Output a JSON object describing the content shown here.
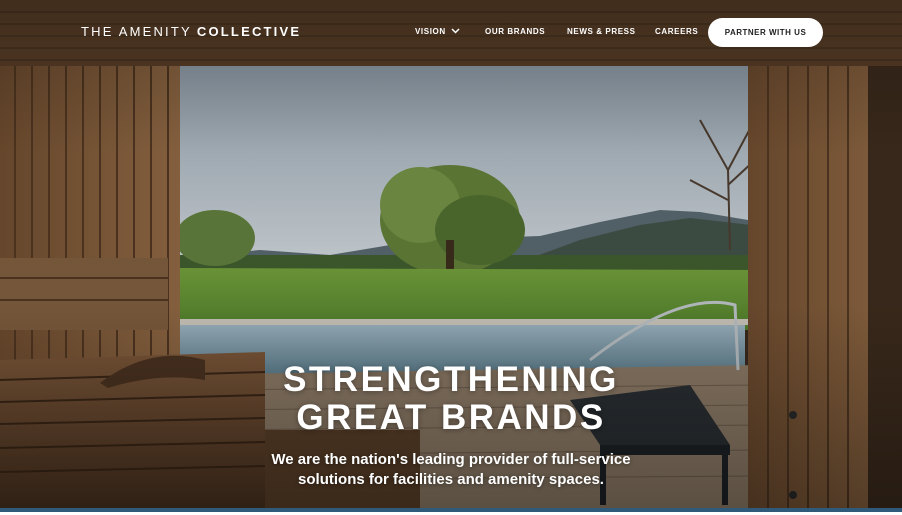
{
  "header": {
    "logo_light": "THE AMENITY",
    "logo_bold": "COLLECTIVE",
    "nav": [
      {
        "label": "VISION",
        "has_dropdown": true
      },
      {
        "label": "OUR BRANDS"
      },
      {
        "label": "NEWS & PRESS"
      },
      {
        "label": "CAREERS"
      }
    ],
    "cta_label": "PARTNER WITH US"
  },
  "hero": {
    "headline_line1": "STRENGTHENING",
    "headline_line2": "GREAT BRANDS",
    "sub_line1": "We are the nation's leading provider of full-service",
    "sub_line2": "solutions for facilities and amenity spaces."
  },
  "colors": {
    "text": "#ffffff",
    "cta_bg": "#ffffff",
    "cta_text": "#1e1e1e",
    "accent_bar": "#2f5a7a"
  },
  "icons": {
    "dropdown": "chevron-down-icon"
  }
}
